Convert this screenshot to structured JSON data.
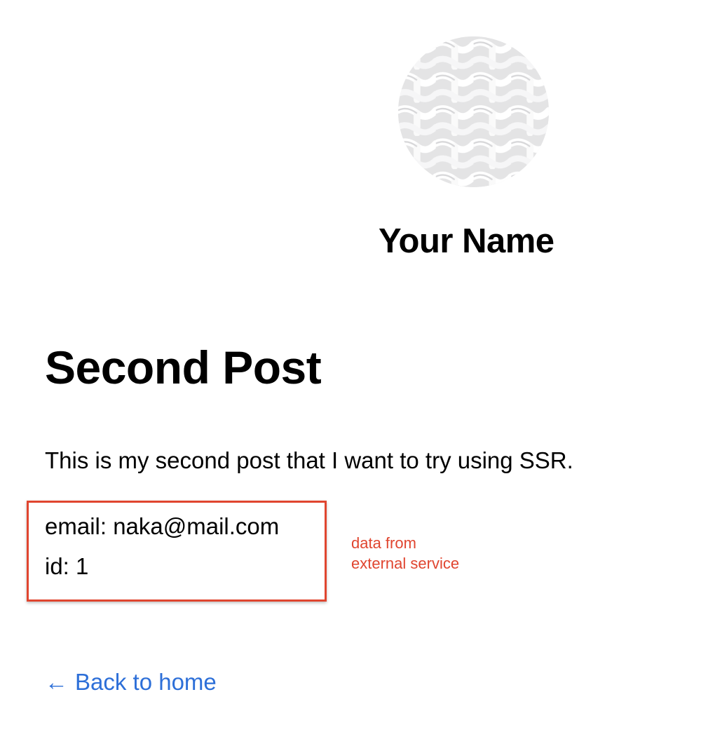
{
  "header": {
    "avatar_alt": "profile avatar",
    "site_name": "Your Name"
  },
  "post": {
    "title": "Second Post",
    "body": "This is my second post that I want to try using SSR.",
    "external": {
      "email_line": "email: naka@mail.com",
      "id_line": "id: 1"
    }
  },
  "annotation": {
    "line1": "data from",
    "line2": "external service",
    "color": "#e0452f"
  },
  "footer": {
    "back_arrow": "←",
    "back_label": "Back to home",
    "link_color": "#2d6fd8"
  }
}
